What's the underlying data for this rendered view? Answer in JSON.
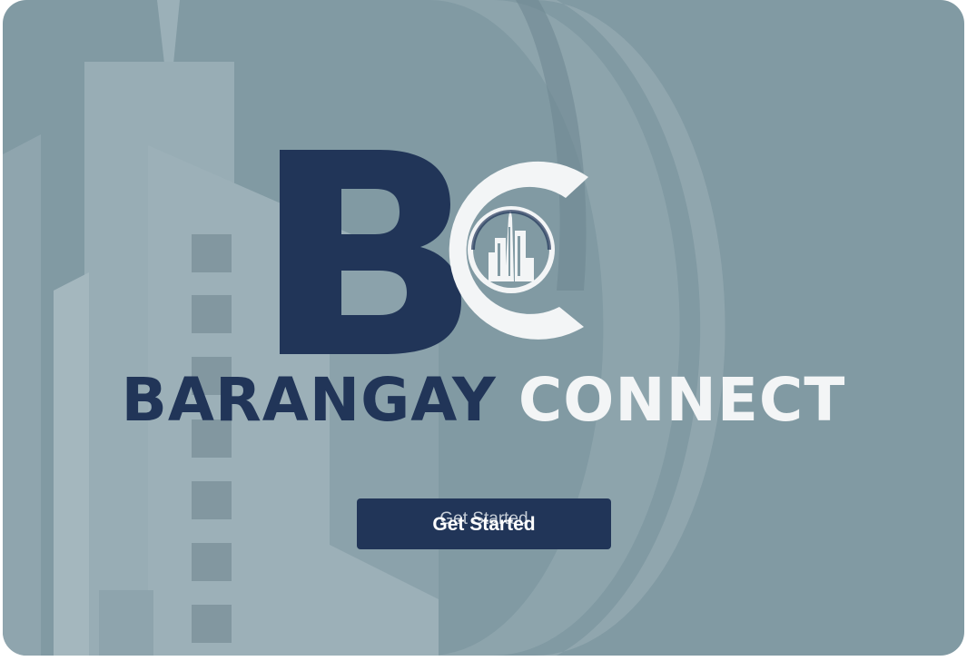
{
  "brand": {
    "logo_letters": "BC",
    "title_word_1": "BARANGAY",
    "title_word_2": "CONNECT"
  },
  "actions": {
    "get_started_label": "Get Started"
  },
  "icons": {
    "logo": "city-buildings-icon",
    "background": "city-skyline-illustration"
  },
  "colors": {
    "background": "#819aa3",
    "navy": "#213558",
    "white": "#f3f5f6"
  }
}
